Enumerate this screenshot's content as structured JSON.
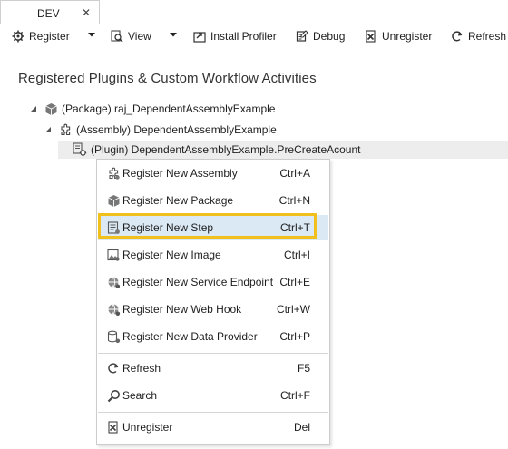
{
  "tab": {
    "label": "DEV",
    "close": "✕"
  },
  "toolbar": {
    "register": "Register",
    "view": "View",
    "install_profiler": "Install Profiler",
    "debug": "Debug",
    "unregister": "Unregister",
    "refresh": "Refresh"
  },
  "heading": "Registered Plugins & Custom Workflow Activities",
  "tree": {
    "package": "(Package) raj_DependentAssemblyExample",
    "assembly": "(Assembly) DependentAssemblyExample",
    "plugin": "(Plugin) DependentAssemblyExample.PreCreateAcount"
  },
  "context_menu": {
    "items": [
      {
        "label": "Register New Assembly",
        "shortcut": "Ctrl+A",
        "icon": "assembly-icon"
      },
      {
        "label": "Register New Package",
        "shortcut": "Ctrl+N",
        "icon": "package-icon"
      },
      {
        "label": "Register New Step",
        "shortcut": "Ctrl+T",
        "icon": "step-icon",
        "highlighted": true
      },
      {
        "label": "Register New Image",
        "shortcut": "Ctrl+I",
        "icon": "image-icon"
      },
      {
        "label": "Register New Service Endpoint",
        "shortcut": "Ctrl+E",
        "icon": "service-endpoint-icon"
      },
      {
        "label": "Register New Web Hook",
        "shortcut": "Ctrl+W",
        "icon": "web-hook-icon"
      },
      {
        "label": "Register New Data Provider",
        "shortcut": "Ctrl+P",
        "icon": "data-provider-icon"
      },
      {
        "label": "Refresh",
        "shortcut": "F5",
        "icon": "refresh-icon"
      },
      {
        "label": "Search",
        "shortcut": "Ctrl+F",
        "icon": "search-icon"
      },
      {
        "label": "Unregister",
        "shortcut": "Del",
        "icon": "unregister-icon"
      }
    ]
  },
  "colors": {
    "highlight": "#dbe9f5",
    "focus_border": "#f2c01c",
    "selected_row": "#ededed"
  }
}
